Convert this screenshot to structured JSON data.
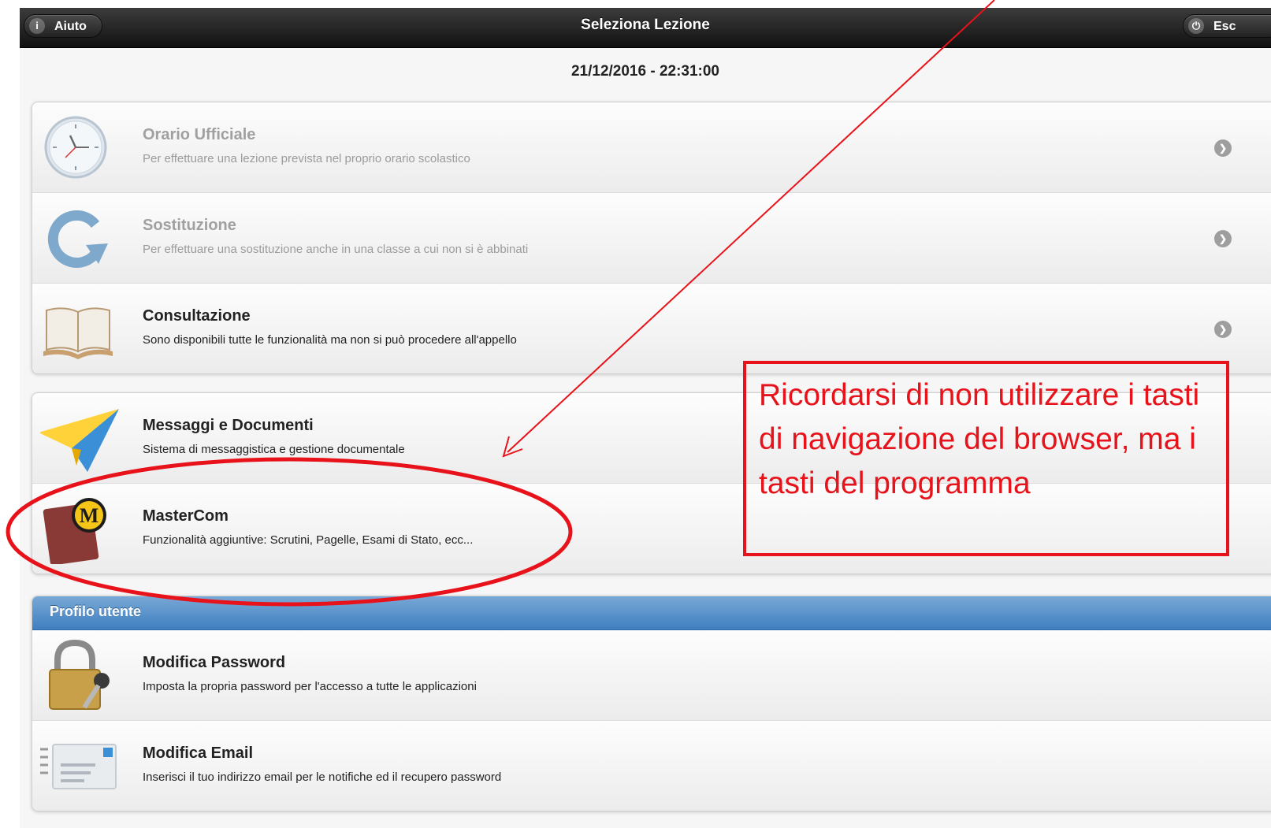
{
  "header": {
    "help_label": "Aiuto",
    "title": "Seleziona Lezione",
    "exit_label": "Esc"
  },
  "datetime": "21/12/2016 - 22:31:00",
  "lessons": [
    {
      "label": "Orario Ufficiale",
      "desc": "Per effettuare una lezione prevista nel proprio orario scolastico",
      "icon": "clock-icon",
      "enabled": false
    },
    {
      "label": "Sostituzione",
      "desc": "Per effettuare una sostituzione anche in una classe a cui non si è abbinati",
      "icon": "refresh-icon",
      "enabled": false
    },
    {
      "label": "Consultazione",
      "desc": "Sono disponibili tutte le funzionalità ma non si può procedere all'appello",
      "icon": "book-icon",
      "enabled": true
    }
  ],
  "tools": [
    {
      "label": "Messaggi e Documenti",
      "desc": "Sistema di messaggistica e gestione documentale",
      "icon": "paper-plane-icon"
    },
    {
      "label": "MasterCom",
      "desc": "Funzionalità aggiuntive: Scrutini, Pagelle, Esami di Stato, ecc...",
      "icon": "mastercom-logo-icon"
    }
  ],
  "profile": {
    "divider": "Profilo utente",
    "items": [
      {
        "label": "Modifica Password",
        "desc": "Imposta la propria password per l'accesso a tutte le applicazioni",
        "icon": "padlock-icon"
      },
      {
        "label": "Modifica Email",
        "desc": "Inserisci il tuo indirizzo email per le notifiche ed il recupero password",
        "icon": "email-icon"
      }
    ]
  },
  "annotation": {
    "text": "Ricordarsi di non utilizzare i tasti di navigazione del browser, ma i tasti del programma",
    "color": "#e8121a"
  },
  "colors": {
    "header": "#1a1a1a",
    "divider_blue": "#4a88c6"
  }
}
